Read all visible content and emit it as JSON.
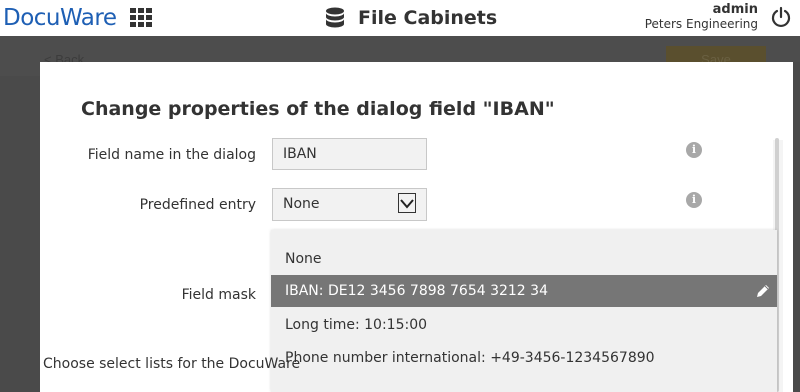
{
  "header": {
    "logo_text": "DocuWare",
    "app_title": "File Cabinets",
    "user": "admin",
    "organization": "Peters Engineering"
  },
  "toolbar": {
    "back_label": "< Back",
    "save_label": "Save"
  },
  "dialog": {
    "title": "Change properties of the dialog field \"IBAN\"",
    "field_name_label": "Field name in the dialog",
    "field_name_value": "IBAN",
    "predefined_entry_label": "Predefined entry",
    "predefined_entry_value": "None",
    "field_mask_label": "Field mask",
    "select_lists_text": "Choose select lists for the DocuWare",
    "info_glyph": "i"
  },
  "field_mask_options": [
    {
      "label": "None",
      "selected": false
    },
    {
      "label": "IBAN: DE12 3456 7898 7654 3212 34",
      "selected": true
    },
    {
      "label": "Long time: 10:15:00",
      "selected": false
    },
    {
      "label": "Phone number international: +49-3456-1234567890",
      "selected": false
    }
  ],
  "colors": {
    "brand": "#1e5fb4",
    "selected_row": "#767676",
    "overlay": "#4a4a4a"
  },
  "icons": [
    "app-grid-icon",
    "database-icon",
    "power-icon",
    "info-icon",
    "chevron-down-icon",
    "pencil-icon"
  ]
}
